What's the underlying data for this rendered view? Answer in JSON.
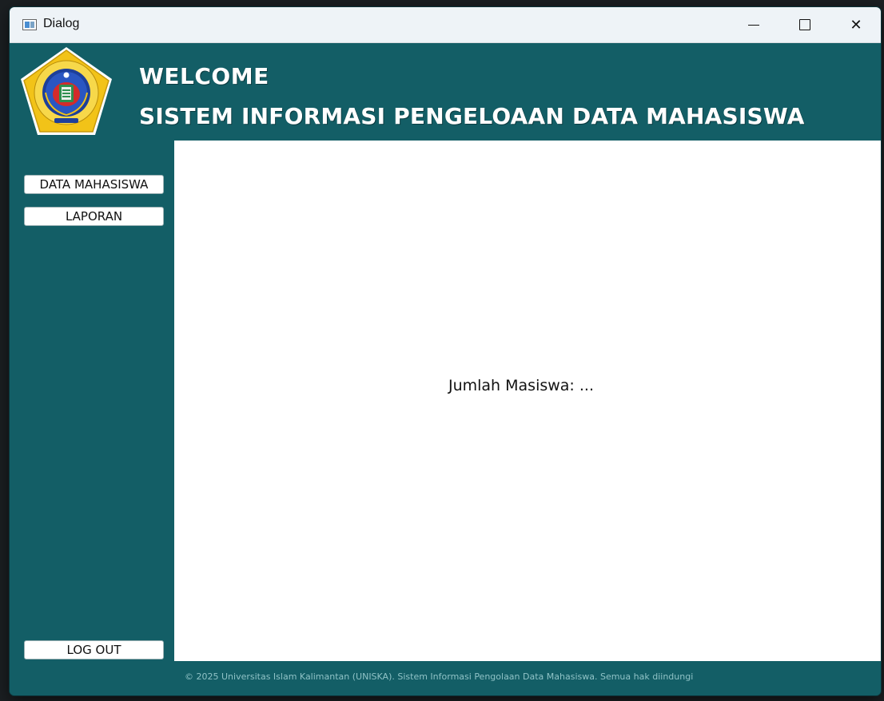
{
  "window": {
    "title": "Dialog",
    "controls": {
      "minimize": "",
      "maximize": "",
      "close": "✕"
    }
  },
  "header": {
    "line1": "WELCOME",
    "line2": "SISTEM INFORMASI PENGELOAAN DATA MAHASISWA"
  },
  "sidebar": {
    "items": [
      {
        "label": "DATA MAHASISWA"
      },
      {
        "label": "LAPORAN"
      }
    ],
    "logout_label": "LOG OUT"
  },
  "main": {
    "count_text": "Jumlah Masiswa: ..."
  },
  "footer": {
    "text": "© 2025 Universitas Islam Kalimantan (UNISKA). Sistem Informasi Pengolaan Data Mahasiswa. Semua hak diindungi"
  },
  "colors": {
    "theme": "#135e66",
    "panel": "#ffffff",
    "logo_gold": "#f2c318",
    "logo_blue": "#1d3f9a"
  }
}
